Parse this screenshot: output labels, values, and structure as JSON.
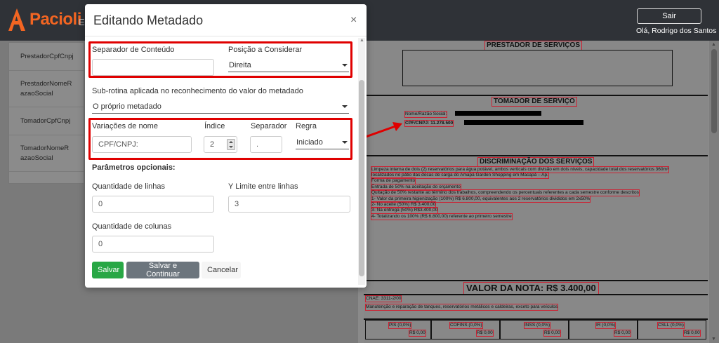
{
  "app": {
    "brand": "Pacioli",
    "nav_stub": "E",
    "logout_label": "Sair",
    "user_greeting": "Olá, Rodrigo dos Santos",
    "brand_color": "#f26522"
  },
  "left_list": {
    "items": [
      "PrestadorCpfCnpj",
      "PrestadorNomeRazaoSocial",
      "TomadorCpfCnpj",
      "TomadorNomeRazaoSocial"
    ]
  },
  "modal": {
    "title": "Editando Metadado",
    "close_label": "×",
    "separador_conteudo": {
      "label": "Separador de Conteúdo",
      "value": ""
    },
    "posicao": {
      "label": "Posição a Considerar",
      "value": "Direita"
    },
    "subrotina": {
      "label": "Sub-rotina aplicada no reconhecimento do valor do metadado",
      "value": "O próprio metadado"
    },
    "variacoes": {
      "label": "Variações de nome",
      "value": "CPF/CNPJ:"
    },
    "indice": {
      "label": "Índice",
      "value": "2"
    },
    "separador": {
      "label": "Separador",
      "value": "."
    },
    "regra": {
      "label": "Regra",
      "value": "Iniciado"
    },
    "parametros_title": "Parâmetros opcionais:",
    "qtd_linhas": {
      "label": "Quantidade de linhas",
      "value": "0"
    },
    "y_limite": {
      "label": "Y Limite entre linhas",
      "value": "3"
    },
    "qtd_colunas": {
      "label": "Quantidade de colunas",
      "value": "0"
    },
    "buttons": {
      "save": "Salvar",
      "save_continue": "Salvar e Continuar",
      "cancel": "Cancelar"
    }
  },
  "document": {
    "prestador_title": "PRESTADOR DE SERVIÇOS",
    "tomador_title": "TOMADOR DE SERVIÇO",
    "tomador_nome": "Nome/Razão Social:",
    "tomador_cpf": "CPF/CNPJ: 11.278.500",
    "discriminacao_title": "DISCRIMINAÇÃO DOS SERVIÇOS",
    "lines": [
      "Limpeza interna de dois (2) reservatórios para água potável, ambos verticais com divisão em dois níveis, capacidade total dos reservatórios 360m³",
      "localizados no pátio das docas de carga do Amapá Garden Shopping em Macapá – Ap.",
      "Forma de pagamento",
      "Entrada de 50% na aceitação do orçamento",
      "Quitação de 50% restante ao término dos trabalhos, compreendendo os percentuais referentes a cada semestre conforme descritos",
      "1- Valor da primeira higienização (100%) R$ 6.800,00, equivalentes aos 2 reservatórios divididos em 2x50%",
      "2- No aceite (50%) R$ 3.400,00",
      "3- Na entrega (50%) R$3.400,00",
      "4- Totalizando os 100% (R$ 6.800,00) referente ao primeiro semestre"
    ],
    "valor_nota": "VALOR DA NOTA: R$ 3.400,00",
    "cnae": "CNAE: 3311-2/00",
    "cnae_desc": "Manutenção e reparação de tanques, reservatórios metálicos e caldeiras, exceto para veículos",
    "taxes": [
      {
        "name": "PIS (0,0%)",
        "value": "R$ 0,00"
      },
      {
        "name": "COFINS (0,0%)",
        "value": "R$ 0,00"
      },
      {
        "name": "INSS (0,0%)",
        "value": "R$ 0,00"
      },
      {
        "name": "IR (0,0%)",
        "value": "R$ 0,00"
      },
      {
        "name": "CSLL (0,0%)",
        "value": "R$ 0,00"
      }
    ]
  },
  "colors": {
    "highlight_red": "#e00000",
    "save_green": "#28a745",
    "navbar": "#2f3237"
  }
}
